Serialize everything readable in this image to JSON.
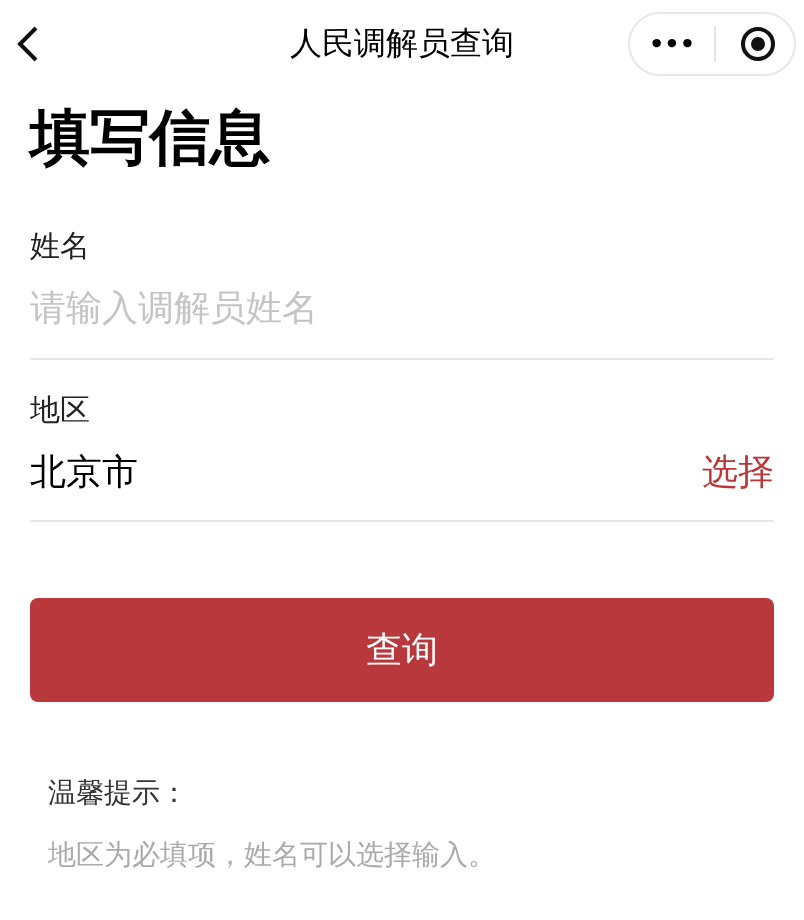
{
  "nav_bar": {
    "title": "人民调解员查询",
    "more_glyph": "•••"
  },
  "heading": "填写信息",
  "fields": [
    {
      "kind": "input",
      "label": "姓名",
      "placeholder": "请输入调解员姓名"
    },
    {
      "kind": "select",
      "label": "地区",
      "value": "北京市",
      "action": "选择"
    }
  ],
  "submit_button": "查询",
  "tip": {
    "title": "温馨提示：",
    "text": "地区为必填项，姓名可以选择输入。"
  }
}
